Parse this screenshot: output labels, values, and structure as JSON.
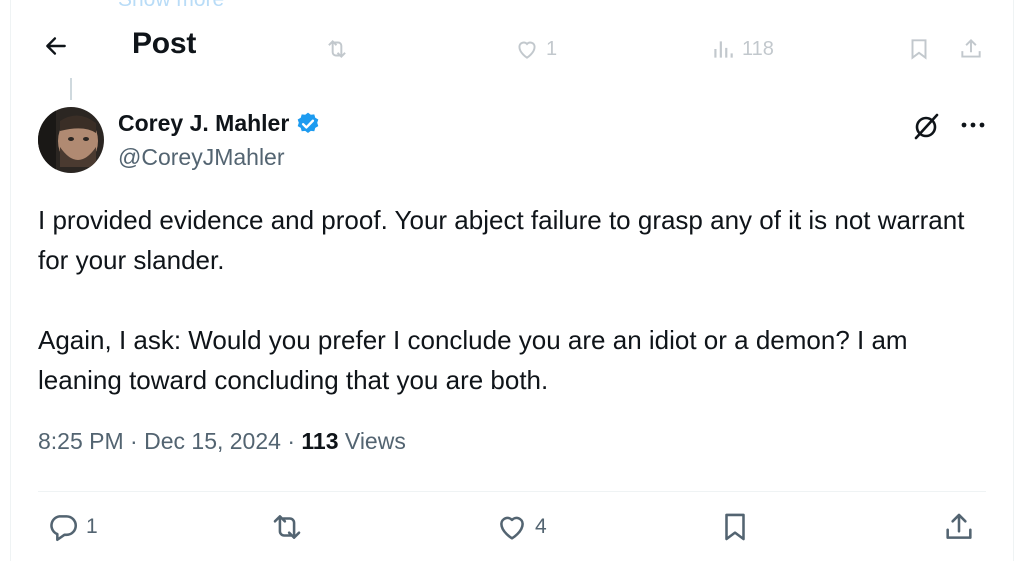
{
  "ghost": {
    "show_more": "Show more",
    "like_count": "1",
    "view_count": "118"
  },
  "header": {
    "title": "Post"
  },
  "author": {
    "name": "Corey J. Mahler",
    "handle": "@CoreyJMahler"
  },
  "tweet": {
    "paragraphs": [
      "I provided evidence and proof. Your abject failure to grasp any of it is not warrant for your slander.",
      "Again, I ask: Would you prefer I conclude you are an idiot or a demon? I am leaning toward concluding that you are both."
    ],
    "time": "8:25 PM",
    "date": "Dec 15, 2024",
    "views_count": "113",
    "views_label": "Views"
  },
  "actions": {
    "reply_count": "1",
    "like_count": "4"
  },
  "colors": {
    "text": "#0f1419",
    "muted": "#536471",
    "verified": "#1d9bf0",
    "border": "#eff3f4"
  },
  "icons": [
    "back-arrow-icon",
    "verified-badge-icon",
    "grok-icon",
    "more-icon",
    "reply-icon",
    "retweet-icon",
    "like-icon",
    "bookmark-icon",
    "share-icon",
    "views-icon"
  ]
}
